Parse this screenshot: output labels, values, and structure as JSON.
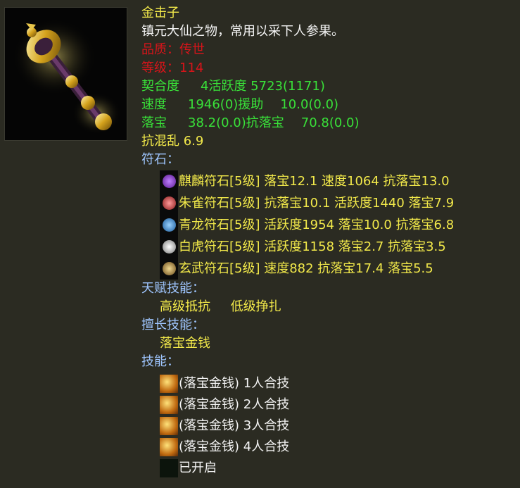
{
  "item": {
    "name": "金击子",
    "description": "镇元大仙之物，常用以采下人参果。",
    "quality": "品质：传世",
    "level": "等级：114",
    "stats": {
      "affinity_label": "契合度",
      "affinity_value": "4活跃度  5723(1171)",
      "speed_label": "速度",
      "speed_value": "1946(0)援助",
      "assist_value": "10.0(0.0)",
      "loot_label": "落宝",
      "loot_value": "38.2(0.0)抗落宝",
      "anti_loot_value": "70.8(0.0)",
      "anti_chaos": "抗混乱 6.9"
    }
  },
  "runes": {
    "header": "符石：",
    "items": [
      {
        "text": "麒麟符石[5级] 落宝12.1 速度1064 抗落宝13.0",
        "icon": "qilin-rune-icon",
        "color": "#8a3fd0"
      },
      {
        "text": "朱雀符石[5级] 抗落宝10.1 活跃度1440 落宝7.9",
        "icon": "zhuque-rune-icon",
        "color": "#c03a3a"
      },
      {
        "text": "青龙符石[5级] 活跃度1954 落宝10.0 抗落宝6.8",
        "icon": "qinglong-rune-icon",
        "color": "#3a8ac8"
      },
      {
        "text": "白虎符石[5级] 活跃度1158 落宝2.7 抗落宝3.5",
        "icon": "baihu-rune-icon",
        "color": "#d8d8d8"
      },
      {
        "text": "玄武符石[5级] 速度882 抗落宝17.4 落宝5.5",
        "icon": "xuanwu-rune-icon",
        "color": "#b89a5a"
      }
    ]
  },
  "talent": {
    "header": "天赋技能：",
    "value": "高级抵抗     低级挣扎"
  },
  "specialty": {
    "header": "擅长技能：",
    "value": "落宝金钱"
  },
  "skills": {
    "header": "技能：",
    "items": [
      {
        "text": "(落宝金钱) 1人合技",
        "icon": "gold-coin-skill-icon"
      },
      {
        "text": "(落宝金钱) 2人合技",
        "icon": "gold-coin-skill-icon"
      },
      {
        "text": "(落宝金钱) 3人合技",
        "icon": "gold-coin-skill-icon"
      },
      {
        "text": "(落宝金钱) 4人合技",
        "icon": "gold-coin-skill-icon"
      }
    ],
    "locked": {
      "text": "已开启",
      "icon": "locked-slot-icon"
    }
  }
}
